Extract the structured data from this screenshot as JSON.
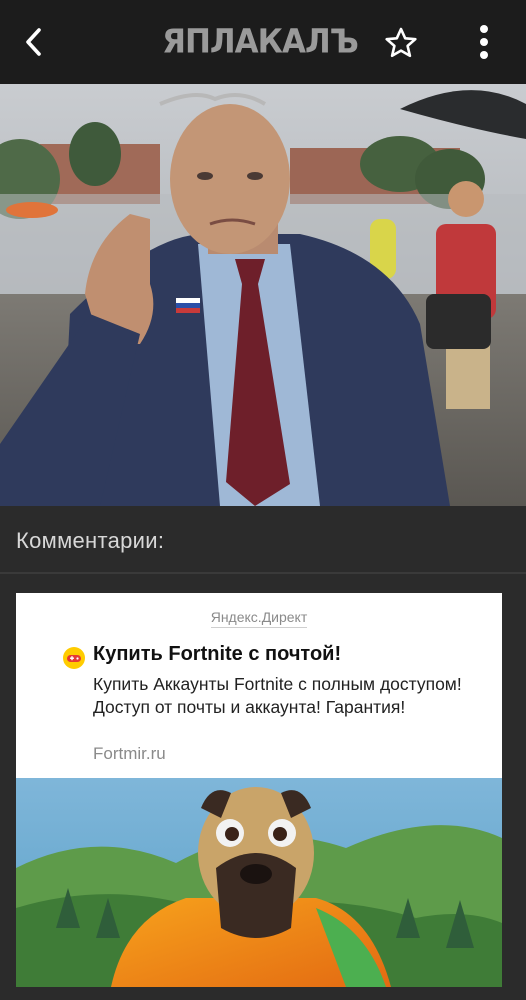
{
  "header": {
    "logo_text": "ЯПЛАКАЛЪ",
    "back_icon": "chevron-left-icon",
    "favorite_icon": "star-outline-icon",
    "menu_icon": "more-vertical-icon"
  },
  "post": {
    "image": "photo-man-in-suit-waving"
  },
  "comments": {
    "title": "Комментарии:"
  },
  "ad": {
    "source": "Яндекс.Директ",
    "icon": "gamepad-icon",
    "title": "Купить Fortnite с почтой!",
    "body": "Купить Аккаунты Fortnite с полным доступом! Доступ от почты и аккаунта! Гарантия!",
    "domain": "Fortmir.ru",
    "image": "fortnite-pug-character-banner"
  },
  "colors": {
    "topbar": "#1c1c1c",
    "background": "#2b2b2b",
    "logo": "#9a9a9a",
    "icons": "#ffffff",
    "ad_bg": "#ffffff"
  }
}
